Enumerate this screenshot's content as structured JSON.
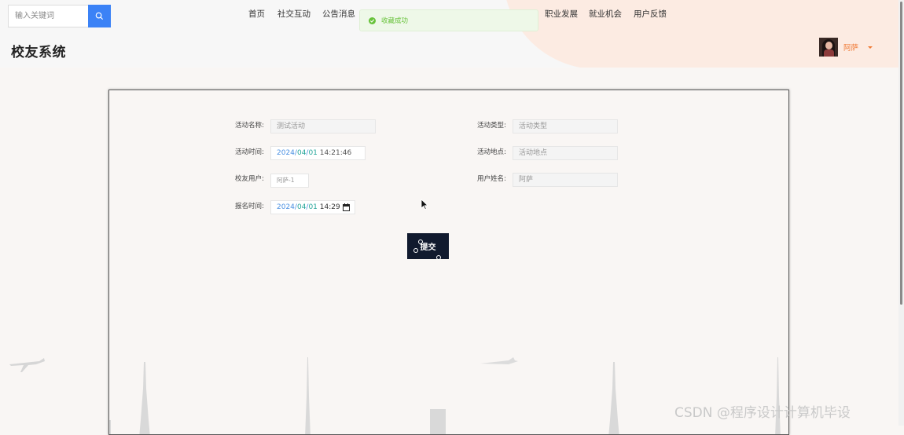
{
  "header": {
    "search": {
      "placeholder": "输入关键词"
    },
    "nav_left": [
      "首页",
      "社交互动",
      "公告消息"
    ],
    "nav_right": [
      "职业发展",
      "就业机会",
      "用户反馈"
    ],
    "site_title": "校友系统",
    "user": {
      "name": "阿萨"
    }
  },
  "toast": {
    "message": "收藏成功",
    "color": "#67c23a"
  },
  "form": {
    "activity_name": {
      "label": "活动名称:",
      "value": "测试活动"
    },
    "activity_type": {
      "label": "活动类型:",
      "placeholder": "活动类型"
    },
    "activity_time": {
      "label": "活动时间:",
      "year": "2024",
      "month": "04",
      "day": "01",
      "time": "14:21:46"
    },
    "activity_location": {
      "label": "活动地点:",
      "placeholder": "活动地点"
    },
    "alumni_user": {
      "label": "校友用户:",
      "value": "阿萨-1"
    },
    "user_real_name": {
      "label": "用户姓名:",
      "value": "阿萨"
    },
    "signup_time": {
      "label": "报名时间:",
      "year": "2024",
      "month": "04",
      "day": "01",
      "time": "14:29"
    },
    "submit_label": "提交"
  },
  "watermark": "CSDN @程序设计计算机毕设",
  "colors": {
    "accent": "#3b82f6",
    "user": "#f07a35",
    "submit_bg": "#111a2e"
  }
}
